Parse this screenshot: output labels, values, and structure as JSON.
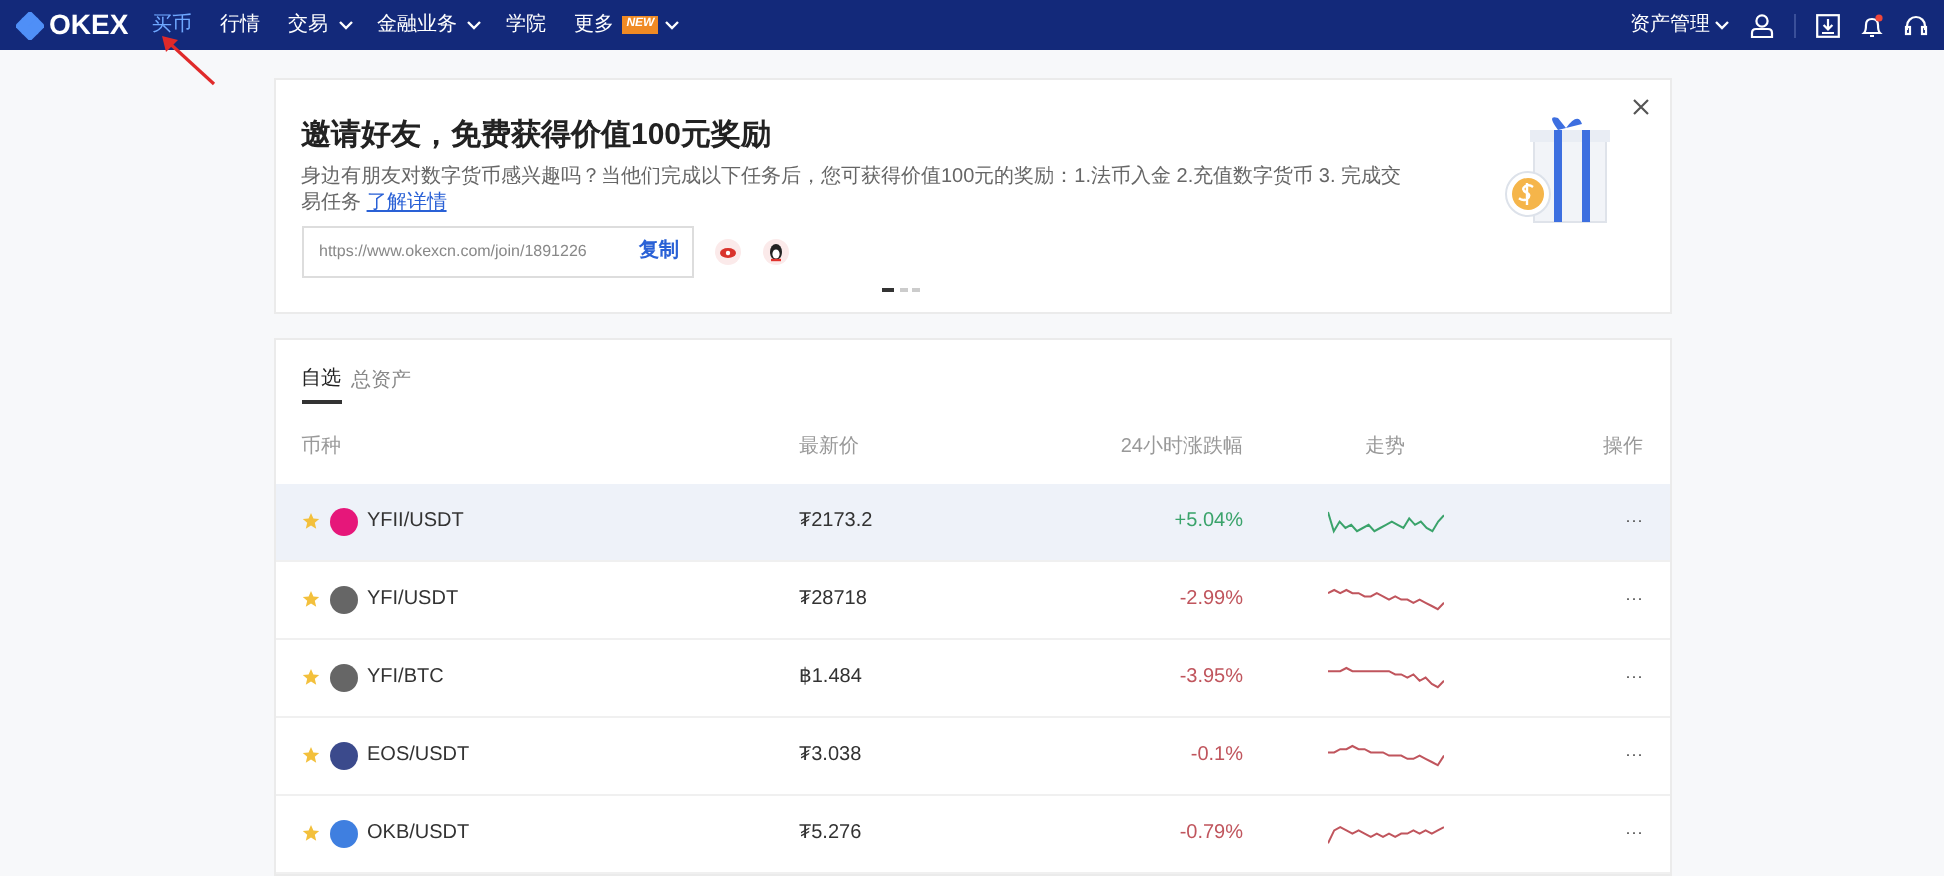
{
  "navbar": {
    "logo": "OKEX",
    "items": [
      {
        "label": "买币",
        "selected": true,
        "dropdown": false
      },
      {
        "label": "行情",
        "selected": false,
        "dropdown": false
      },
      {
        "label": "交易",
        "selected": false,
        "dropdown": true
      },
      {
        "label": "金融业务",
        "selected": false,
        "dropdown": true
      },
      {
        "label": "学院",
        "selected": false,
        "dropdown": false
      },
      {
        "label": "更多",
        "selected": false,
        "dropdown": true,
        "badge": "NEW"
      }
    ],
    "asset_menu": "资产管理",
    "notification_dot": true
  },
  "invite_banner": {
    "title": "邀请好友，免费获得价值100元奖励",
    "description": "身边有朋友对数字货币感兴趣吗？当他们完成以下任务后，您可获得价值100元的奖励：1.法币入金 2.充值数字货币 3. 完成交易任务",
    "link": "了解详情",
    "invite_url": "https://www.okexcn.com/join/1891226",
    "copy_button": "复制",
    "slides": [
      {
        "selected": true
      },
      {
        "selected": false
      },
      {
        "selected": false
      }
    ]
  },
  "tabs": [
    {
      "label": "自选",
      "selected": true
    },
    {
      "label": "总资产",
      "selected": false
    }
  ],
  "table": {
    "columns": [
      "币种",
      "最新价",
      "24小时涨跌幅",
      "走势",
      "操作"
    ],
    "rows": [
      {
        "pair": "YFII/USDT",
        "price": "₮2173.2",
        "change": "+5.04%",
        "kind": "up",
        "color": "#e6177a",
        "favorite": true,
        "highlighted": true,
        "action": "···"
      },
      {
        "pair": "YFI/USDT",
        "price": "₮28718",
        "change": "-2.99%",
        "kind": "down",
        "color": "#666666",
        "favorite": true,
        "highlighted": false,
        "action": "···"
      },
      {
        "pair": "YFI/BTC",
        "price": "฿1.484",
        "change": "-3.95%",
        "kind": "down",
        "color": "#666666",
        "favorite": true,
        "highlighted": false,
        "action": "···"
      },
      {
        "pair": "EOS/USDT",
        "price": "₮3.038",
        "change": "-0.1%",
        "kind": "down",
        "color": "#3b4a8c",
        "favorite": true,
        "highlighted": false,
        "action": "···"
      },
      {
        "pair": "OKB/USDT",
        "price": "₮5.276",
        "change": "-0.79%",
        "kind": "down",
        "color": "#3f7fe0",
        "favorite": true,
        "highlighted": false,
        "action": "···"
      }
    ]
  }
}
